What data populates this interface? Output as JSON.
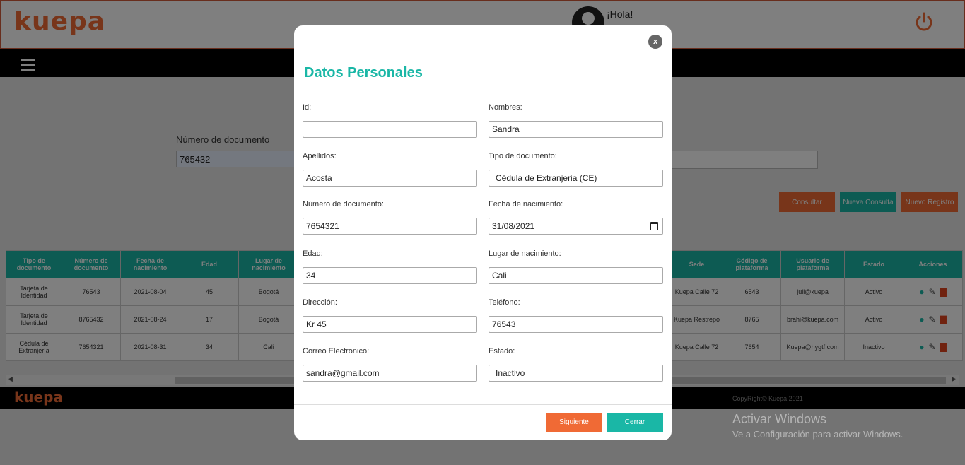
{
  "app": {
    "logo": "kuepa",
    "greeting": "¡Hola!",
    "greeting_sub": "",
    "footer_logo": "kuepa",
    "copyright": "CopyRight© Kuepa 2021"
  },
  "search": {
    "label": "Número de documento",
    "value": "765432"
  },
  "actions": {
    "consultar": "Consultar",
    "nueva_consulta": "Nueva Consulta",
    "nuevo_registro": "Nuevo Registro"
  },
  "table": {
    "left_headers": [
      "Tipo de documento",
      "Número de documento",
      "Fecha de nacimiento",
      "Edad",
      "Lugar de nacimiento"
    ],
    "right_headers": [
      "Sede",
      "Código de plataforma",
      "Usuario de plataforma",
      "Estado",
      "Acciones"
    ],
    "rows": [
      {
        "tipo": "Tarjeta de Identidad",
        "numero": "76543",
        "fecha": "2021-08-04",
        "edad": "45",
        "lugar": "Bogotá",
        "sede": "Kuepa Calle 72",
        "codigo": "6543",
        "usuario": "juli@kuepa",
        "estado": "Activo"
      },
      {
        "tipo": "Tarjeta de Identidad",
        "numero": "8765432",
        "fecha": "2021-08-24",
        "edad": "17",
        "lugar": "Bogotá",
        "sede": "Kuepa Restrepo",
        "codigo": "8765",
        "usuario": "brahi@kuepa.com",
        "estado": "Activo"
      },
      {
        "tipo": "Cédula de Extranjería",
        "numero": "7654321",
        "fecha": "2021-08-31",
        "edad": "34",
        "lugar": "Cali",
        "sede": "Kuepa Calle 72",
        "codigo": "7654",
        "usuario": "Kuepa@hygtf.com",
        "estado": "Inactivo"
      }
    ]
  },
  "modal": {
    "title": "Datos Personales",
    "close": "x",
    "fields": {
      "id": {
        "label": "Id:",
        "value": ""
      },
      "nombres": {
        "label": "Nombres:",
        "value": "Sandra"
      },
      "apellidos": {
        "label": "Apellidos:",
        "value": "Acosta"
      },
      "tipo_documento": {
        "label": "Tipo de documento:",
        "value": "Cédula de Extranjeria (CE)"
      },
      "numero_documento": {
        "label": "Número de documento:",
        "value": "7654321"
      },
      "fecha_nacimiento": {
        "label": "Fecha de nacimiento:",
        "value": "31/08/2021"
      },
      "edad": {
        "label": "Edad:",
        "value": "34"
      },
      "lugar_nacimiento": {
        "label": "Lugar de nacimiento:",
        "value": "Cali"
      },
      "direccion": {
        "label": "Dirección:",
        "value": "Kr 45"
      },
      "telefono": {
        "label": "Teléfono:",
        "value": "76543"
      },
      "correo": {
        "label": "Correo Electronico:",
        "value": "sandra@gmail.com"
      },
      "estado": {
        "label": "Estado:",
        "value": "Inactivo"
      }
    },
    "buttons": {
      "siguiente": "Siguiente",
      "cerrar": "Cerrar"
    }
  },
  "windows_watermark": {
    "title": "Activar Windows",
    "subtitle": "Ve a Configuración para activar Windows."
  },
  "colors": {
    "brand_orange": "#f06a35",
    "brand_teal": "#1ab7a6"
  }
}
